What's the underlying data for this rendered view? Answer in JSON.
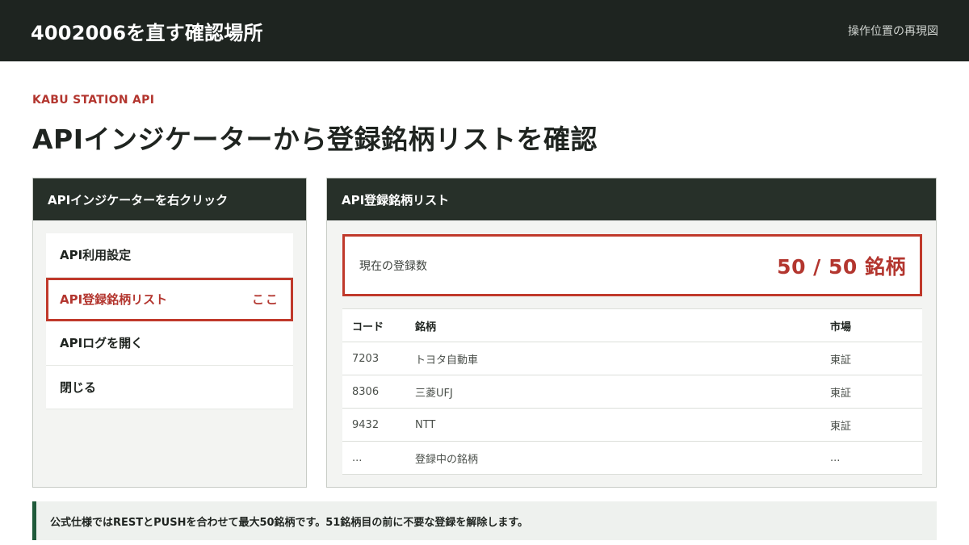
{
  "header": {
    "title": "4002006を直す確認場所",
    "link_label": "操作位置の再現図"
  },
  "eyebrow": "KABU STATION API",
  "page_title": "APIインジケーターから登録銘柄リストを確認",
  "left_panel": {
    "heading": "APIインジケーターを右クリック",
    "menu_items": [
      {
        "label": "API利用設定"
      },
      {
        "label": "API登録銘柄リスト",
        "marker": "ここ"
      },
      {
        "label": "APIログを開く"
      },
      {
        "label": "閉じる"
      }
    ]
  },
  "right_panel": {
    "heading": "API登録銘柄リスト",
    "count_label": "現在の登録数",
    "count_value": "50 / 50 銘柄",
    "table": {
      "headers": [
        "コード",
        "銘柄",
        "市場"
      ],
      "rows": [
        [
          "7203",
          "トヨタ自動車",
          "東証"
        ],
        [
          "8306",
          "三菱UFJ",
          "東証"
        ],
        [
          "9432",
          "NTT",
          "東証"
        ],
        [
          "...",
          "登録中の銘柄",
          "..."
        ]
      ]
    }
  },
  "notice": "公式仕様ではRESTとPUSHを合わせて最大50銘柄です。51銘柄目の前に不要な登録を解除します。",
  "colors": {
    "topbar": "#1e2420",
    "accent_red": "#c0392b",
    "panel_header": "#273029",
    "notice_border": "#1f5a3a"
  }
}
